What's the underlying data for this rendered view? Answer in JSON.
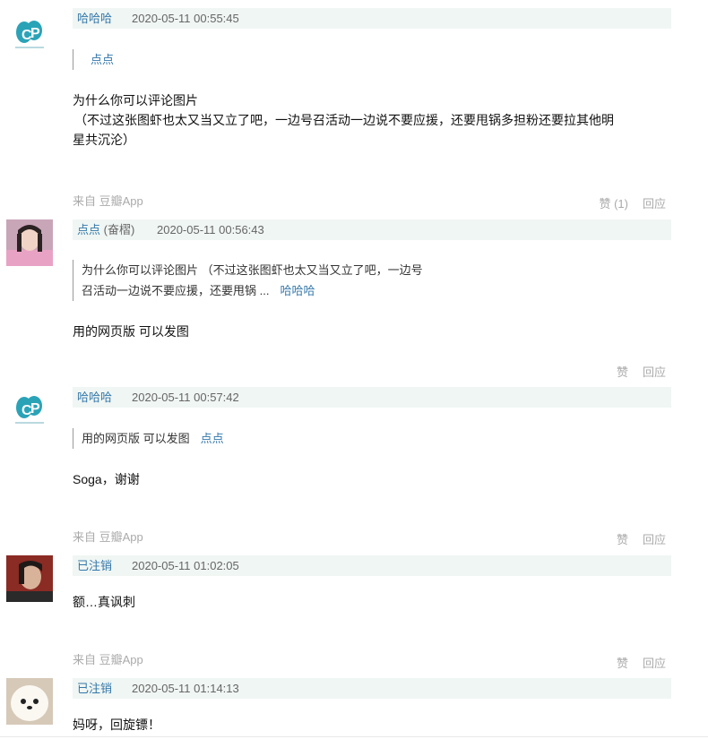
{
  "comments": [
    {
      "author": "哈哈哈",
      "time": "2020-05-11 00:55:45",
      "quote_author": "点点",
      "text_line1": "为什么你可以评论图片",
      "text_line2": "（不过这张图虾也太又当又立了吧，一边号召活动一边说不要应援，还要甩锅多担粉还要拉其他明",
      "text_line3": "星共沉沦）",
      "source": "来自 豆瓣App",
      "like": "赞 (1)",
      "reply": "回应"
    },
    {
      "author": "点点",
      "author_extra": "(奋槢)",
      "time": "2020-05-11 00:56:43",
      "quote_line1": "为什么你可以评论图片 （不过这张图虾也太又当又立了吧，一边号",
      "quote_line2": "召活动一边说不要应援，还要甩锅 ...",
      "quote_author": "哈哈哈",
      "text": "用的网页版 可以发图",
      "like": "赞",
      "reply": "回应"
    },
    {
      "author": "哈哈哈",
      "time": "2020-05-11 00:57:42",
      "quote_text": "用的网页版 可以发图",
      "quote_author": "点点",
      "text": "Soga，谢谢",
      "source": "来自 豆瓣App",
      "like": "赞",
      "reply": "回应"
    },
    {
      "author": "已注销",
      "time": "2020-05-11 01:02:05",
      "text": "额…真讽刺",
      "source": "来自 豆瓣App",
      "like": "赞",
      "reply": "回应"
    },
    {
      "author": "已注销",
      "time": "2020-05-11 01:14:13",
      "text": "妈呀，回旋镖！"
    }
  ],
  "colors": {
    "link": "#3377aa",
    "header_bg": "#f0f6f3",
    "muted": "#aaaaaa"
  }
}
